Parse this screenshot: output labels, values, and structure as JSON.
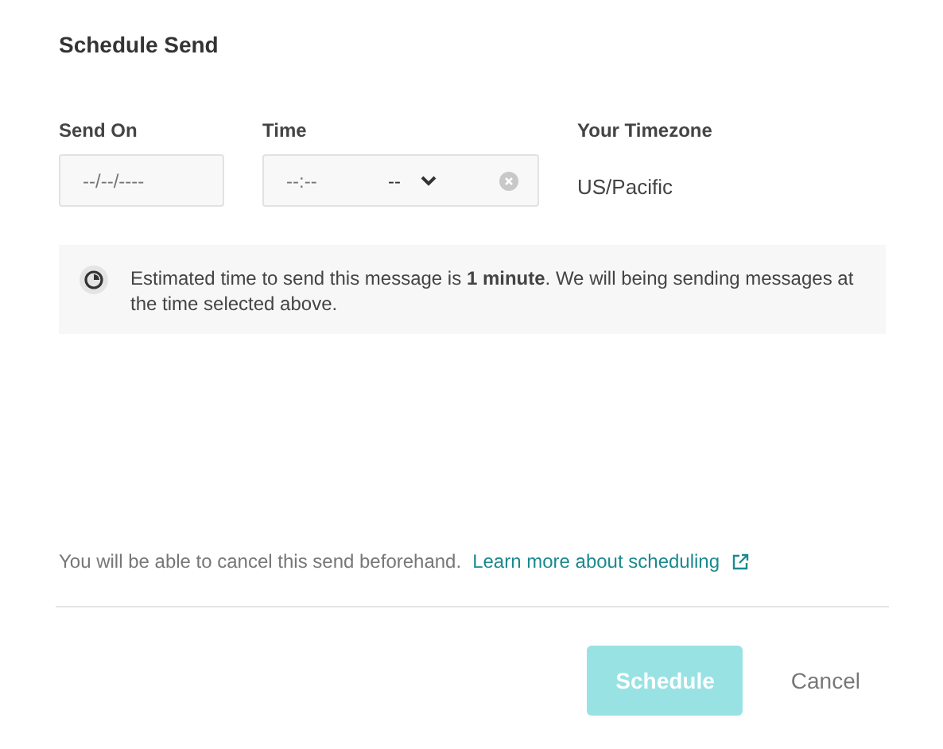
{
  "title": "Schedule Send",
  "fields": {
    "send_on": {
      "label": "Send On",
      "placeholder": "--/--/----"
    },
    "time": {
      "label": "Time",
      "placeholder": "--:--",
      "period": "--"
    },
    "timezone": {
      "label": "Your Timezone",
      "value": "US/Pacific"
    }
  },
  "info": "Estimated time to send this message is **1 minute**. We will being sending messages at the time selected above.",
  "note": "You will be able to cancel this send beforehand.",
  "link": "Learn more about scheduling",
  "buttons": [
    {
      "kind": "primary",
      "label": "Schedule",
      "disabled": true
    },
    {
      "kind": "plain",
      "label": "Cancel",
      "disabled": false
    }
  ]
}
